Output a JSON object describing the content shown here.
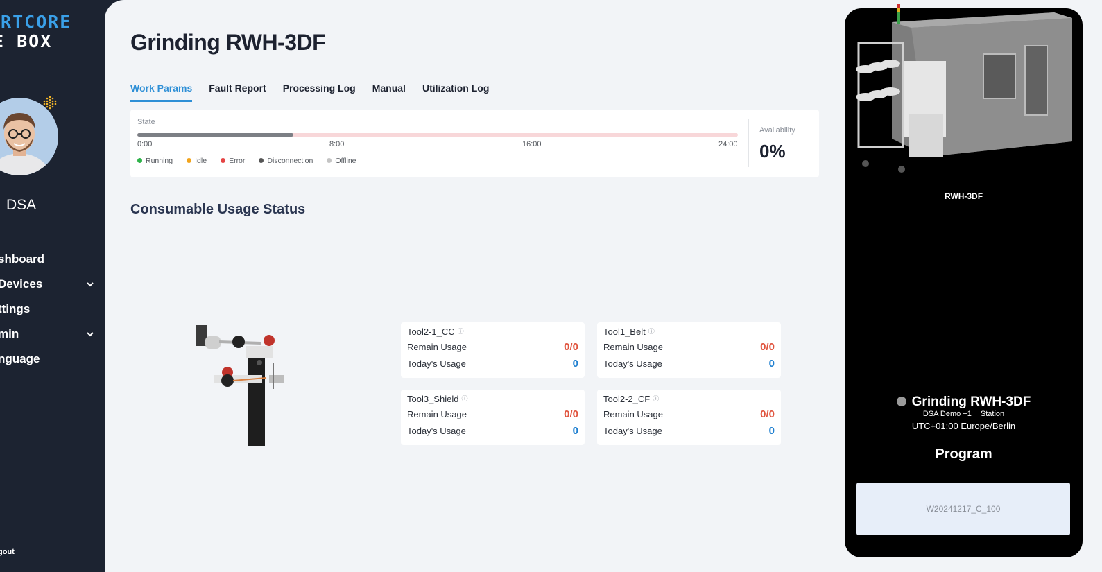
{
  "sidebar": {
    "logo_line1": "ARTCORE",
    "logo_line2": "E BOX",
    "username": "DSA",
    "nav": [
      {
        "label": "shboard",
        "has_chevron": false
      },
      {
        "label": " Devices",
        "has_chevron": true
      },
      {
        "label": "ttings",
        "has_chevron": false
      },
      {
        "label": "min",
        "has_chevron": true
      },
      {
        "label": "nguage",
        "has_chevron": false
      }
    ],
    "logout": "gout"
  },
  "main": {
    "title": "Grinding RWH-3DF",
    "tabs": [
      {
        "label": "Work Params",
        "active": true
      },
      {
        "label": "Fault Report",
        "active": false
      },
      {
        "label": "Processing Log",
        "active": false
      },
      {
        "label": "Manual",
        "active": false
      },
      {
        "label": "Utilization Log",
        "active": false
      }
    ],
    "state": {
      "label": "State",
      "progress_fraction": 0.26,
      "ticks": [
        "0:00",
        "8:00",
        "16:00",
        "24:00"
      ],
      "legend": [
        {
          "label": "Running",
          "color": "#2fb34a"
        },
        {
          "label": "Idle",
          "color": "#f2a41c"
        },
        {
          "label": "Error",
          "color": "#e54545"
        },
        {
          "label": "Disconnection",
          "color": "#555555"
        },
        {
          "label": "Offline",
          "color": "#c4c4c4"
        }
      ],
      "availability_label": "Availability",
      "availability_value": "0%"
    },
    "consumables_title": "Consumable Usage Status",
    "consumables": [
      {
        "name": "Tool2-1_CC",
        "remain_label": "Remain Usage",
        "remain": "0/0",
        "today_label": "Today's Usage",
        "today": "0"
      },
      {
        "name": "Tool1_Belt",
        "remain_label": "Remain Usage",
        "remain": "0/0",
        "today_label": "Today's Usage",
        "today": "0"
      },
      {
        "name": "Tool3_Shield",
        "remain_label": "Remain Usage",
        "remain": "0/0",
        "today_label": "Today's Usage",
        "today": "0"
      },
      {
        "name": "Tool2-2_CF",
        "remain_label": "Remain Usage",
        "remain": "0/0",
        "today_label": "Today's Usage",
        "today": "0"
      }
    ]
  },
  "machine": {
    "model": "RWH-3DF",
    "title": "Grinding RWH-3DF",
    "sub_left": "DSA Demo +1",
    "sub_right": "Station",
    "timezone": "UTC+01:00 Europe/Berlin",
    "program_label": "Program",
    "program_value": "W20241217_C_100"
  }
}
